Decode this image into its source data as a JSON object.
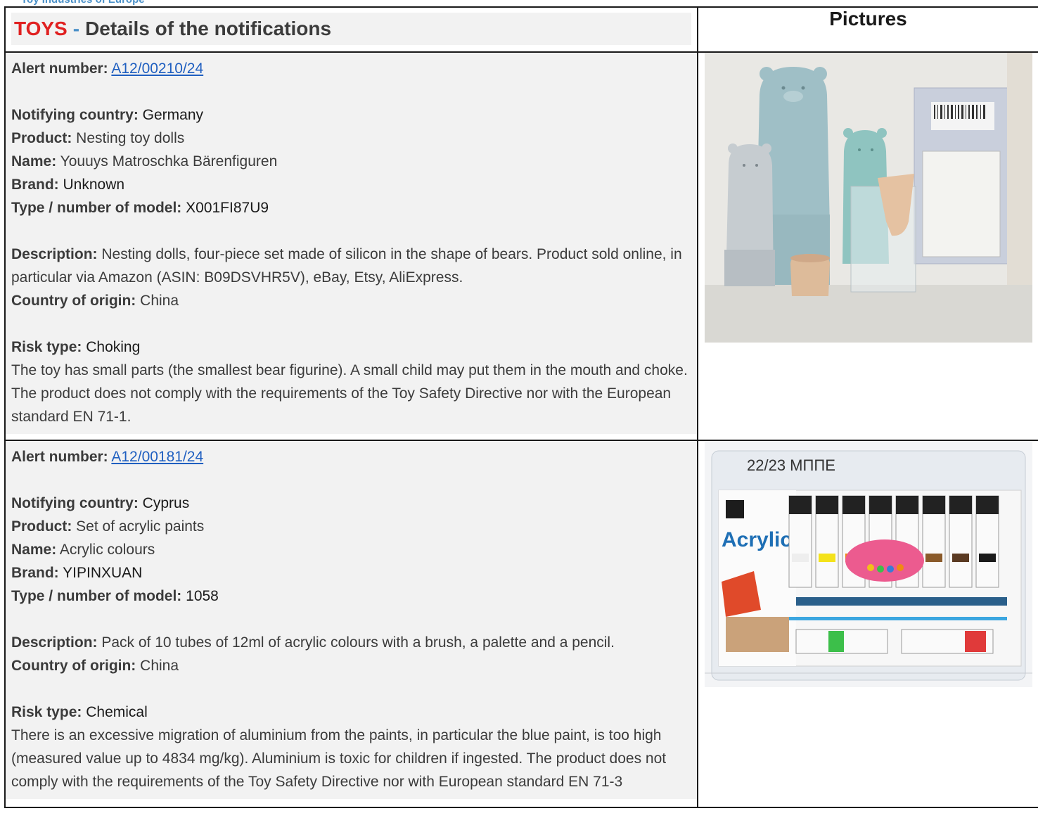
{
  "banner": {
    "text": "Toy Industries of Europe"
  },
  "header": {
    "category": "TOYS",
    "separator": "-",
    "title": "Details of the notifications",
    "pictures_label": "Pictures"
  },
  "labels": {
    "alert_number": "Alert number:",
    "notifying_country": "Notifying country:",
    "product": "Product:",
    "name": "Name:",
    "brand": "Brand:",
    "model": "Type / number of model:",
    "description": "Description:",
    "origin": "Country of origin:",
    "risk_type": "Risk type:"
  },
  "notifications": [
    {
      "alert_number": "A12/00210/24",
      "notifying_country": "Germany",
      "product": "Nesting toy dolls",
      "name": "Youuys Matroschka Bärenfiguren",
      "brand": "Unknown",
      "model": "X001FI87U9",
      "description": "Nesting dolls, four-piece set made of silicon in the shape of bears. Product sold online, in particular via Amazon (ASIN: B09DSVHR5V), eBay, Etsy, AliExpress.",
      "origin": "China",
      "risk_type": "Choking",
      "risk_text": "The toy has small parts (the smallest bear figurine). A small child may put them in the mouth and choke. The product does not comply with the requirements of the Toy Safety Directive nor with the European standard EN 71-1.",
      "photo_alt": "nesting bear dolls photo"
    },
    {
      "alert_number": "A12/00181/24",
      "notifying_country": "Cyprus",
      "product": "Set of acrylic paints",
      "name": "Acrylic colours",
      "brand": "YIPINXUAN",
      "model": "1058",
      "description": "Pack of 10 tubes of 12ml of acrylic colours with a brush, a palette and a pencil.",
      "origin": "China",
      "risk_type": "Chemical",
      "risk_text": "There is an excessive migration of aluminium from the paints, in particular the blue paint, is too high (measured value up to 4834 mg/kg). Aluminium is toxic for children if ingested. The product does not comply with the requirements of the Toy Safety Directive nor with European standard EN 71-3",
      "photo_alt": "acrylic paint set photo",
      "photo_caption": "22/23 ΜΠΠΕ",
      "package_label": "Acrylic"
    }
  ]
}
